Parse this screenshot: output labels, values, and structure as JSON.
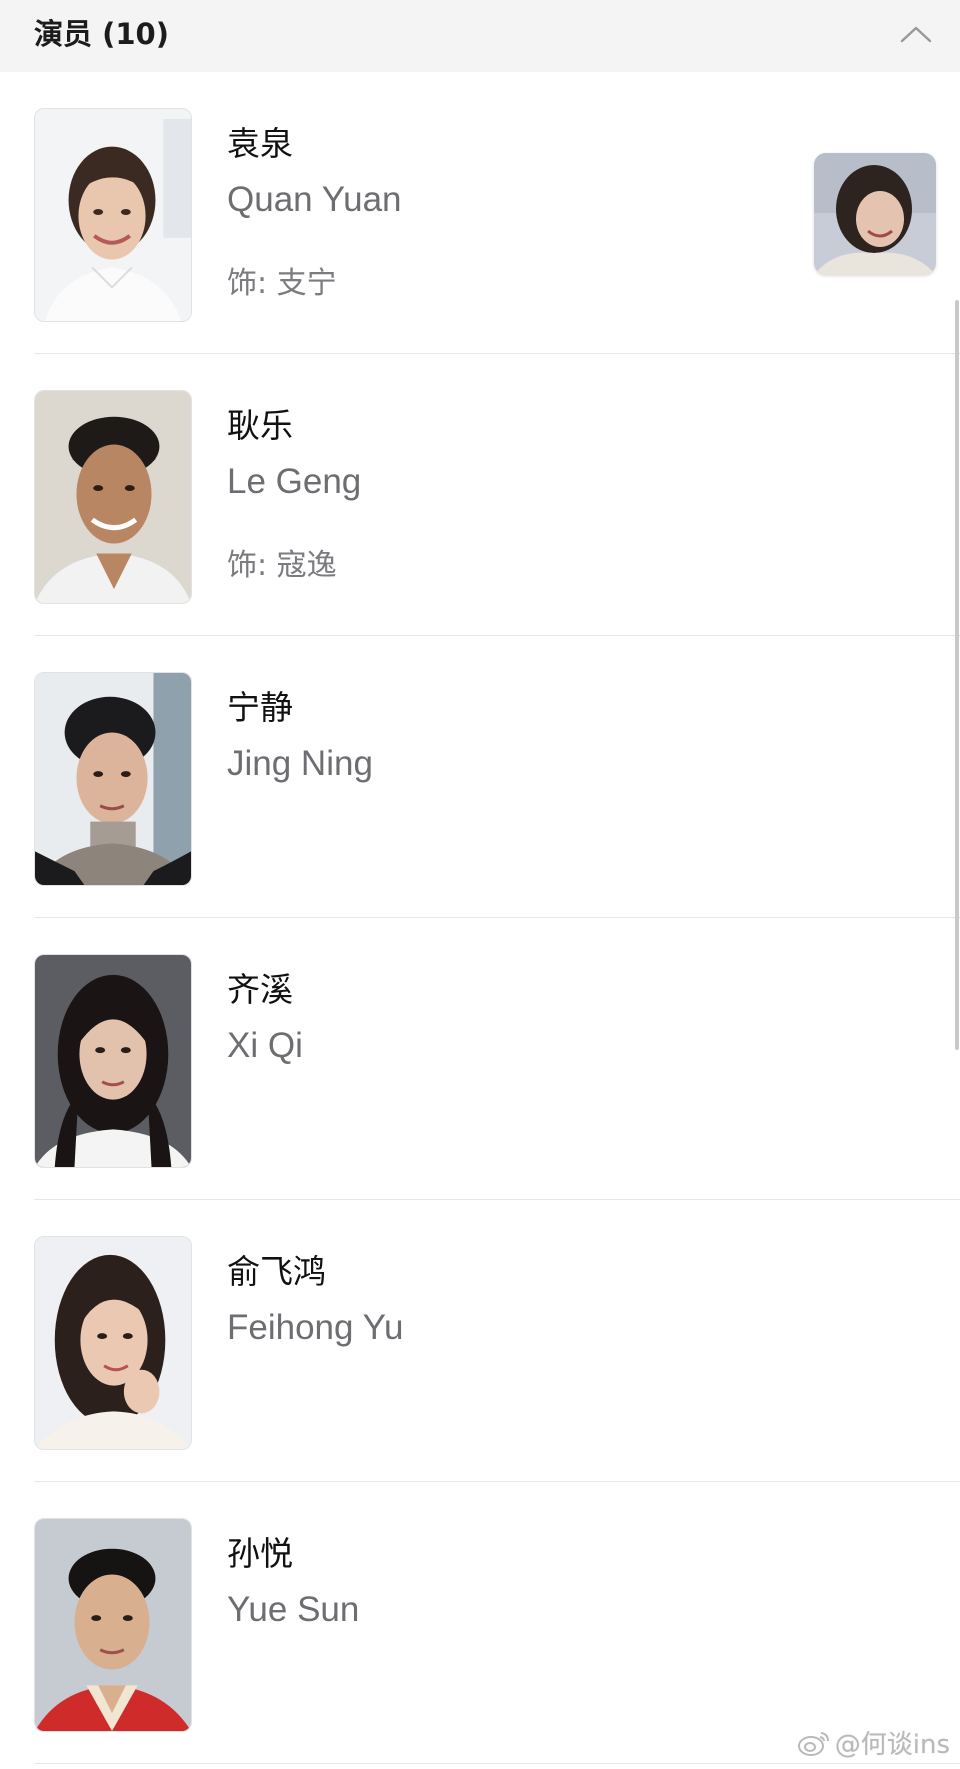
{
  "header": {
    "title": "演员 (10)",
    "collapse_icon": "chevron-up-icon"
  },
  "cast": [
    {
      "name_cn": "袁泉",
      "name_en": "Quan Yuan",
      "role": "饰: 支宁",
      "has_thumbnail": true
    },
    {
      "name_cn": "耿乐",
      "name_en": "Le Geng",
      "role": "饰: 寇逸"
    },
    {
      "name_cn": "宁静",
      "name_en": "Jing Ning"
    },
    {
      "name_cn": "齐溪",
      "name_en": "Xi Qi"
    },
    {
      "name_cn": "俞飞鸿",
      "name_en": "Feihong Yu"
    },
    {
      "name_cn": "孙悦",
      "name_en": "Yue Sun"
    }
  ],
  "watermark": {
    "text": "@何谈ins",
    "icon": "weibo-icon"
  },
  "colors": {
    "header_bg": "#f4f4f5",
    "divider": "#e6e6e6",
    "secondary_text": "#6d6d72"
  }
}
